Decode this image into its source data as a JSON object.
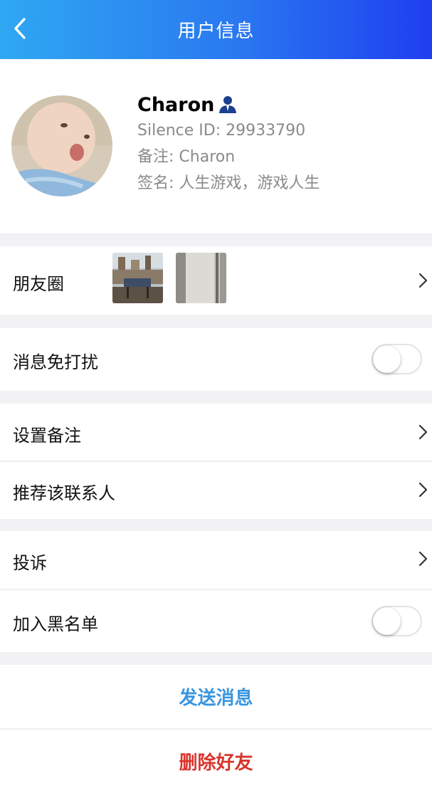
{
  "nav": {
    "title": "用户信息",
    "back_icon": "chevron-left-icon"
  },
  "profile": {
    "name": "Charon",
    "user_badge_icon": "user-badge-icon",
    "silence_id": "Silence ID: 29933790",
    "remark": "备注: Charon",
    "signature": "签名: 人生游戏，游戏人生"
  },
  "moments": {
    "label": "朋友圈",
    "thumbnail_count": 2
  },
  "settings": {
    "dnd_label": "消息免打扰",
    "dnd_on": false,
    "set_remark_label": "设置备注",
    "recommend_label": "推荐该联系人",
    "complain_label": "投诉",
    "blacklist_label": "加入黑名单",
    "blacklist_on": false
  },
  "actions": {
    "send_label": "发送消息",
    "delete_label": "删除好友"
  },
  "colors": {
    "nav_gradient_start": "#2fa8f2",
    "nav_gradient_end": "#1f3ef0",
    "send_color": "#3a96e0",
    "delete_color": "#d9342b",
    "badge_color": "#1d3f8f"
  }
}
